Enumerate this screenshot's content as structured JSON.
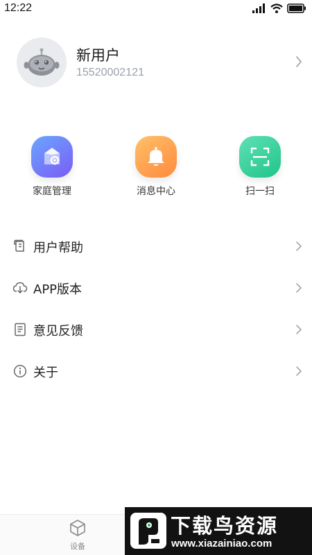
{
  "status_bar": {
    "time": "12:22"
  },
  "profile": {
    "name": "新用户",
    "phone": "15520002121"
  },
  "quick_actions": [
    {
      "label": "家庭管理",
      "icon": "home-gear-icon",
      "color_from": "#6aa6ff",
      "color_to": "#7b5cf5"
    },
    {
      "label": "消息中心",
      "icon": "bell-icon",
      "color_from": "#ffc06a",
      "color_to": "#ff8a3d"
    },
    {
      "label": "扫一扫",
      "icon": "scan-icon",
      "color_from": "#5fe0b5",
      "color_to": "#21c48a"
    }
  ],
  "menu": [
    {
      "label": "用户帮助",
      "icon": "help-scroll-icon"
    },
    {
      "label": "APP版本",
      "icon": "cloud-download-icon"
    },
    {
      "label": "意见反馈",
      "icon": "document-icon"
    },
    {
      "label": "关于",
      "icon": "info-icon"
    }
  ],
  "bottom_nav": {
    "devices_label": "设备"
  },
  "watermark": {
    "title": "下载鸟资源",
    "url": "www.xiazainiao.com"
  }
}
